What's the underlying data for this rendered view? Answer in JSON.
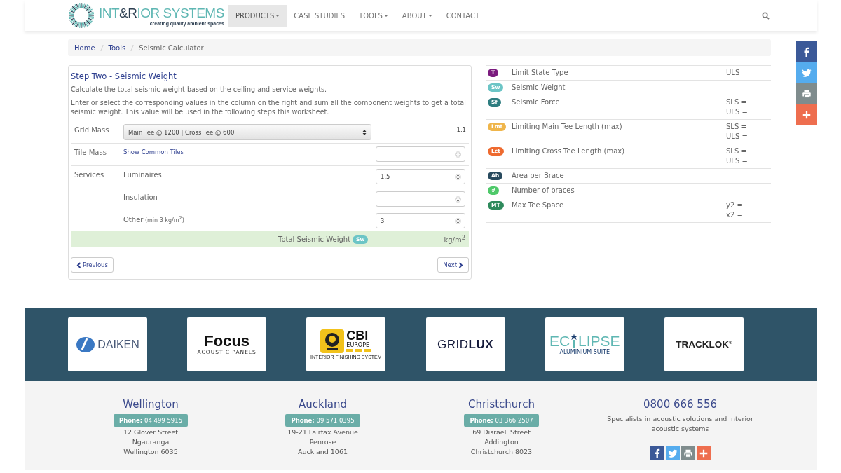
{
  "header": {
    "logo": {
      "parts": [
        {
          "text": "INT",
          "accent": true
        },
        {
          "text": "&R",
          "accent": false
        },
        {
          "text": "IOR SYSTEMS",
          "accent": true
        }
      ],
      "tagline": "creating quality ambient spaces"
    },
    "nav": [
      {
        "label": "PRODUCTS",
        "selected": true,
        "dropdown": true
      },
      {
        "label": "CASE STUDIES",
        "selected": false,
        "dropdown": false
      },
      {
        "label": "TOOLS",
        "selected": false,
        "dropdown": true
      },
      {
        "label": "ABOUT",
        "selected": false,
        "dropdown": true
      },
      {
        "label": "CONTACT",
        "selected": false,
        "dropdown": false
      }
    ]
  },
  "breadcrumb": [
    {
      "label": "Home",
      "link": true
    },
    {
      "label": "Tools",
      "link": true
    },
    {
      "label": "Seismic Calculator",
      "link": false
    }
  ],
  "social": [
    {
      "kind": "facebook",
      "color": "#3b5998"
    },
    {
      "kind": "twitter",
      "color": "#55acee"
    },
    {
      "kind": "print",
      "color": "#7f8c8d"
    },
    {
      "kind": "share",
      "color": "#ee6e4f"
    }
  ],
  "step": {
    "title": "Step Two - Seismic Weight",
    "intro": [
      "Calculate the total seismic weight based on the ceiling and service weights.",
      "Enter or select the corresponding values in the column on the right and sum all the component weights to get a total seismic weight. This value will be used in the following steps this worksheet."
    ],
    "rows": [
      {
        "label": "Grid Mass",
        "items": [
          {
            "kind": "select",
            "value": "Main Tee @ 1200 | Cross Tee @ 600",
            "result": "1.1"
          }
        ]
      },
      {
        "label": "Tile Mass",
        "items": [
          {
            "kind": "link",
            "text": "Show Common Tiles"
          }
        ]
      },
      {
        "label": "Services",
        "items": [
          {
            "kind": "number",
            "text": "Luminaires",
            "value": "1.5"
          },
          {
            "kind": "number",
            "text": "Insulation"
          },
          {
            "kind": "number",
            "text": "Other",
            "note": "(min 3 kg/m$^{2}$)",
            "value": "3"
          }
        ]
      }
    ],
    "total": {
      "label": "Total Seismic Weight",
      "badge": "Sw",
      "unit": "kg/m$^{2}$"
    },
    "buttons": {
      "previous": "Previous",
      "next": "Next"
    }
  },
  "results": [
    {
      "badge": "T",
      "color": "#7b1b7e",
      "label": "Limit State Type",
      "values": [
        "ULS"
      ]
    },
    {
      "badge": "Sw",
      "color": "#6cc5c6",
      "label": "Seismic Weight"
    },
    {
      "badge": "Sf",
      "color": "#2e7d80",
      "label": "Seismic Force",
      "values": [
        "SLS =",
        "ULS ="
      ]
    },
    {
      "badge": "Lmt",
      "color": "#efb54a",
      "label": "Limiting Main Tee Length (max)",
      "values": [
        "SLS =",
        "ULS ="
      ]
    },
    {
      "badge": "Lct",
      "color": "#ee6a2f",
      "label": "Limiting Cross Tee Length (max)",
      "values": [
        "SLS =",
        "ULS ="
      ]
    },
    {
      "badge": "Ab",
      "color": "#284a5e",
      "label": "Area per Brace"
    },
    {
      "badge": "#",
      "color": "#4fc96a",
      "label": "Number of braces"
    },
    {
      "badge": "MT",
      "color": "#2e8a5c",
      "label": "Max Tee Space",
      "values": [
        "y2 =",
        "x2 ="
      ]
    }
  ],
  "partners": [
    {
      "kind": "daiken",
      "name": "DAIKEN"
    },
    {
      "kind": "focus",
      "name": "Focus",
      "tagline": "ACOUSTIC PANELS"
    },
    {
      "kind": "cbi",
      "name": "CBI",
      "subname": "EUROPE",
      "tagline": "INTERIOR FINISHING SYSTEM"
    },
    {
      "kind": "gridlux",
      "name": "GRID**LUX**"
    },
    {
      "kind": "eclipse",
      "name": "EC",
      "name_end": "LIPSE",
      "tagline": "ALUMINIUM SUITE"
    },
    {
      "kind": "tracklok",
      "name": "TRACKLOK$^{®}$"
    }
  ],
  "offices": [
    {
      "city": "Wellington",
      "phone": "**Phone:** 04 499 5915",
      "address": [
        "12 Glover Street",
        "Ngauranga",
        "Wellington 6035"
      ]
    },
    {
      "city": "Auckland",
      "phone": "**Phone:** 09 571 0395",
      "address": [
        "19-21 Fairfax Avenue",
        "Penrose",
        "Auckland 1061"
      ]
    },
    {
      "city": "Christchurch",
      "phone": "**Phone:** 03 366 2507",
      "address": [
        "69 Disraeli Street",
        "Addington",
        "Christchurch 8023"
      ]
    }
  ],
  "contact": {
    "phone": "0800 666 556",
    "text": "Specialists in acoustic solutions and interior acoustic systems",
    "social": [
      {
        "kind": "facebook",
        "color": "#3b5998"
      },
      {
        "kind": "twitter",
        "color": "#55acee"
      },
      {
        "kind": "print",
        "color": "#7f8c8d"
      },
      {
        "kind": "share",
        "color": "#ee6e4f"
      }
    ]
  }
}
